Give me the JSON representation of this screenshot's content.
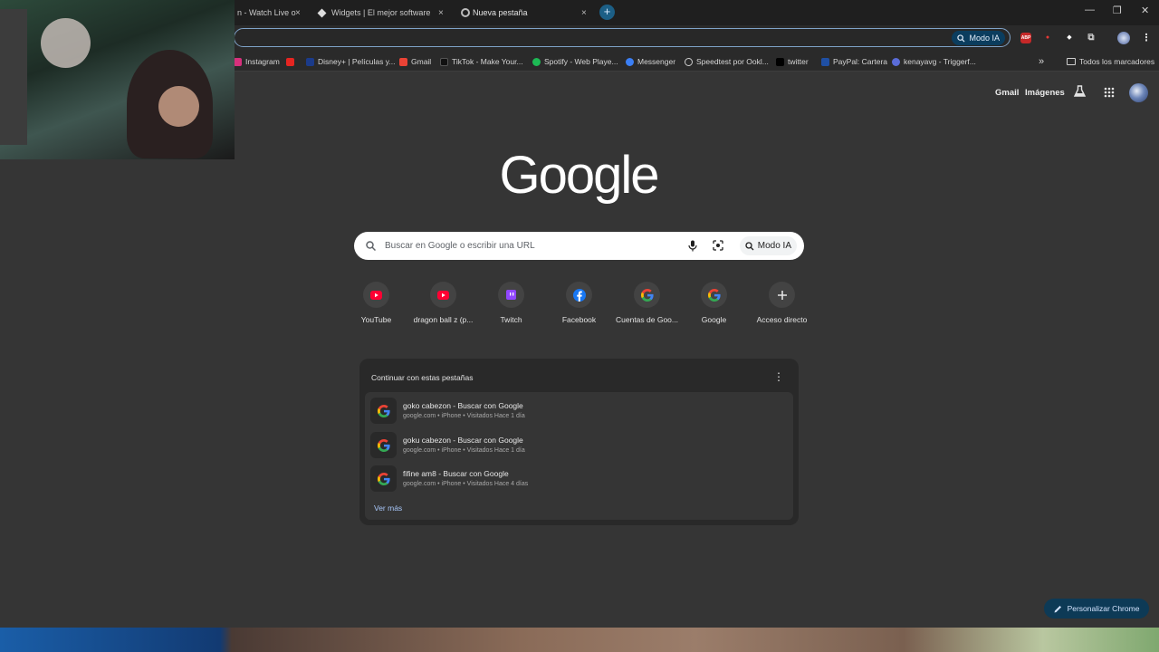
{
  "tabs": [
    {
      "title": "n - Watch Live o",
      "close": "×"
    },
    {
      "title": "Widgets | El mejor software pa",
      "close": "×"
    },
    {
      "title": "Nueva pestaña",
      "close": "×"
    }
  ],
  "new_tab": "+",
  "window_controls": {
    "minimize": "—",
    "restore": "❐",
    "close": "✕"
  },
  "omnibox": {
    "modo_ia": "Modo IA"
  },
  "extensions": [
    {
      "name": "abp-icon",
      "label": "ABP",
      "color": "#c62828"
    },
    {
      "name": "extension-red-icon",
      "label": "●",
      "color": "#d32f2f"
    },
    {
      "name": "extension-diamond-icon",
      "label": "◆",
      "color": "#ffffff"
    },
    {
      "name": "puzzle-icon",
      "label": "⧉",
      "color": "#cfcfcf"
    }
  ],
  "bookmarks": [
    {
      "label": "Instagram",
      "color": "#d6307c"
    },
    {
      "label": "",
      "color": "#e52521"
    },
    {
      "label": "Disney+ | Películas y...",
      "color": "#1b3b8a"
    },
    {
      "label": "Gmail",
      "color": "#ea4335"
    },
    {
      "label": "TikTok - Make Your...",
      "color": "#111111"
    },
    {
      "label": "Spotify - Web Playe...",
      "color": "#1db954"
    },
    {
      "label": "Messenger",
      "color": "#3b7ff5"
    },
    {
      "label": "Speedtest por Ookl...",
      "color": "#222222"
    },
    {
      "label": "twitter",
      "color": "#000000"
    },
    {
      "label": "PayPal: Cartera",
      "color": "#1f4fa3"
    },
    {
      "label": "kenayavg - Triggerf...",
      "color": "#5a6cd8"
    }
  ],
  "bookmarks_overflow": "»",
  "all_bookmarks": "Todos los marcadores",
  "header": {
    "gmail": "Gmail",
    "imagenes": "Imágenes"
  },
  "logo": "Google",
  "search": {
    "placeholder": "Buscar en Google o escribir una URL",
    "modo_ia": "Modo IA"
  },
  "shortcuts": [
    {
      "label": "YouTube",
      "icon": "youtube-icon"
    },
    {
      "label": "dragon ball z (p...",
      "icon": "youtube-icon"
    },
    {
      "label": "Twitch",
      "icon": "twitch-icon"
    },
    {
      "label": "Facebook",
      "icon": "facebook-icon"
    },
    {
      "label": "Cuentas de Goo...",
      "icon": "google-icon"
    },
    {
      "label": "Google",
      "icon": "google-icon"
    },
    {
      "label": "Acceso directo",
      "icon": "plus-icon"
    }
  ],
  "continue_card": {
    "title": "Continuar con estas pestañas",
    "menu": "⋮",
    "items": [
      {
        "title": "goko cabezon - Buscar con Google",
        "subtitle": "google.com • iPhone • Visitados Hace 1 día"
      },
      {
        "title": "goku cabezon - Buscar con Google",
        "subtitle": "google.com • iPhone • Visitados Hace 1 día"
      },
      {
        "title": "fifine am8 - Buscar con Google",
        "subtitle": "google.com • iPhone • Visitados Hace 4 días"
      }
    ],
    "more": "Ver más"
  },
  "customize": "Personalizar Chrome"
}
